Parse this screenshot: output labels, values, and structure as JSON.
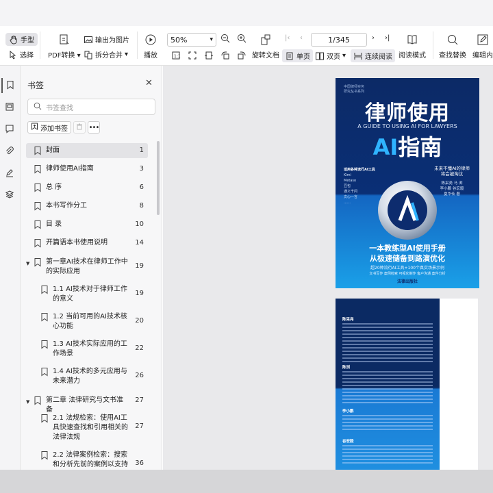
{
  "toolbar": {
    "hand_label": "手型",
    "select_label": "选择",
    "pdf_convert_label": "PDF转换",
    "export_image_label": "输出为图片",
    "split_merge_label": "拆分合并",
    "play_label": "播放",
    "zoom_value": "50%",
    "rotate_label": "旋转文档",
    "page_indicator": "1/345",
    "single_page_label": "单页",
    "double_page_label": "双页",
    "continuous_label": "连续阅读",
    "reading_mode_label": "阅读模式",
    "find_replace_label": "查找替换",
    "edit_label": "编辑内"
  },
  "bookmarks": {
    "title": "书签",
    "search_placeholder": "书签查找",
    "add_label": "添加书签",
    "items": [
      {
        "label": "封面",
        "page": "1"
      },
      {
        "label": "律师使用AI指南",
        "page": "3"
      },
      {
        "label": "总 序",
        "page": "6"
      },
      {
        "label": "本书写作分工",
        "page": "8"
      },
      {
        "label": "目 录",
        "page": "10"
      },
      {
        "label": "开篇语本书使用说明",
        "page": "14"
      },
      {
        "label": "第一章AI技术在律师工作中的实际应用",
        "page": "19"
      },
      {
        "label": "1.1 AI技术对于律师工作的意义",
        "page": "19"
      },
      {
        "label": "1.2 当前可用的AI技术核心功能",
        "page": "20"
      },
      {
        "label": "1.3 AI技术实际应用的工作场景",
        "page": "22"
      },
      {
        "label": "1.4 AI技术的多元应用与未来潜力",
        "page": "26"
      },
      {
        "label": "第二章 法律研究与文书准备",
        "page": "27"
      },
      {
        "label": "2.1 法规检索：使用AI工具快速查找和引用相关的法律法规",
        "page": "27"
      },
      {
        "label": "2.2 法律案例检索：搜索和分析先前的案例以支持当前",
        "page": "36"
      }
    ]
  },
  "cover": {
    "series_small": "中国律师实务\n研究丛书系列",
    "title": "律师使用",
    "subtitle_en": "A GUIDE TO USING AI FOR LAWYERS",
    "ai_text": "AI",
    "guide_text": "指南",
    "tools_heading": "适用各种流行AI工具",
    "tools": [
      "Kimi",
      "Metaso",
      "豆包",
      "通义千问",
      "文心一言",
      "……"
    ],
    "slogan": "未来不懂AI的律师\n将会被淘汰",
    "authors": "陈采尧  马 浏\n李小鹏  谷宏毅\n夏华传  著",
    "line1": "一本教练型AI使用手册",
    "line2": "从极速储备到路演优化",
    "line3": "超20种流行AI工具+100个真实场景示例",
    "line4": "文书写作  案例检索  可视化制作  客户沟通  案件分析",
    "publisher": "法律出版社"
  },
  "page2": {
    "headings": [
      "陈采尧",
      "陈浏",
      "李小鹏",
      "谷宏毅"
    ]
  }
}
